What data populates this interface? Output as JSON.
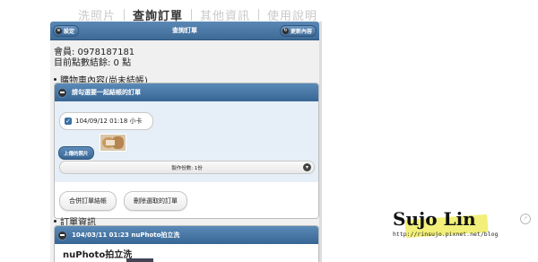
{
  "top_tabs": [
    {
      "label": "洗照片",
      "active": false
    },
    {
      "label": "查詢訂單",
      "active": true
    },
    {
      "label": "其他資訊",
      "active": false
    },
    {
      "label": "使用說明",
      "active": false
    }
  ],
  "header": {
    "title": "查詢訂單",
    "left_button": "設定",
    "right_button": "更新內容",
    "left_icon": "menu-icon",
    "right_icon": "refresh-icon"
  },
  "member": {
    "line1": "會員: 0978187181",
    "line2": "目前點數結餘: 0 點"
  },
  "cart": {
    "label": "購物車內容(尚未結帳)",
    "section_title": "請勾選要一起結帳的訂單",
    "order_checkbox_label": "104/09/12 01:18 小卡",
    "checked": true,
    "upload_label": "上傳的照片",
    "copies_select": "製作份數: 1份",
    "merge_button": "合併訂單結帳",
    "delete_button": "刪除選取的訂單"
  },
  "orders": {
    "label": "訂單資訊",
    "section_title": "104/03/11 01:23 nuPhoto拍立洗",
    "product_title": "nuPhoto拍立洗"
  },
  "watermark": {
    "name": "Sujo Lin",
    "url": "http://rinsujo.pixnet.net/blog"
  },
  "colors": {
    "header_blue": "#4a78a6",
    "panel_bg": "#f0f0f0",
    "highlight_yellow": "#f2ef7a"
  }
}
